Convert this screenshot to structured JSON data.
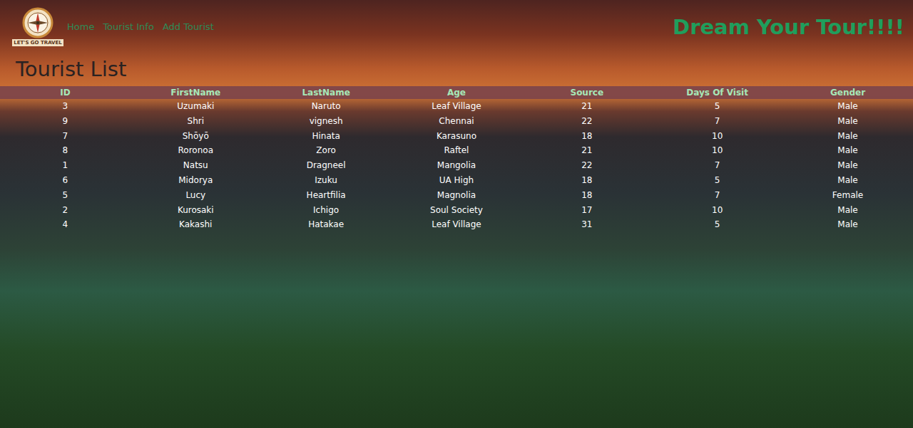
{
  "logo": {
    "text": "LET'S GO TRAVEL"
  },
  "nav": [
    {
      "label": "Home"
    },
    {
      "label": "Tourist Info"
    },
    {
      "label": "Add Tourist"
    }
  ],
  "tagline": "Dream Your Tour!!!!",
  "heading": "Tourist List",
  "table": {
    "columns": [
      "ID",
      "FirstName",
      "LastName",
      "Age",
      "Source",
      "Days Of Visit",
      "Gender"
    ],
    "rows": [
      [
        "3",
        "Uzumaki",
        "Naruto",
        "Leaf Village",
        "21",
        "5",
        "Male"
      ],
      [
        "9",
        "Shri",
        "vignesh",
        "Chennai",
        "22",
        "7",
        "Male"
      ],
      [
        "7",
        "Shōyō",
        "Hinata",
        "Karasuno",
        "18",
        "10",
        "Male"
      ],
      [
        "8",
        "Roronoa",
        "Zoro",
        "Raftel",
        "21",
        "10",
        "Male"
      ],
      [
        "1",
        "Natsu",
        "Dragneel",
        "Mangolia",
        "22",
        "7",
        "Male"
      ],
      [
        "6",
        "Midorya",
        "Izuku",
        "UA High",
        "18",
        "5",
        "Male"
      ],
      [
        "5",
        "Lucy",
        "Heartfilia",
        "Magnolia",
        "18",
        "7",
        "Female"
      ],
      [
        "2",
        "Kurosaki",
        "Ichigo",
        "Soul Society",
        "17",
        "10",
        "Male"
      ],
      [
        "4",
        "Kakashi",
        "Hatakae",
        "Leaf Village",
        "31",
        "5",
        "Male"
      ]
    ]
  }
}
